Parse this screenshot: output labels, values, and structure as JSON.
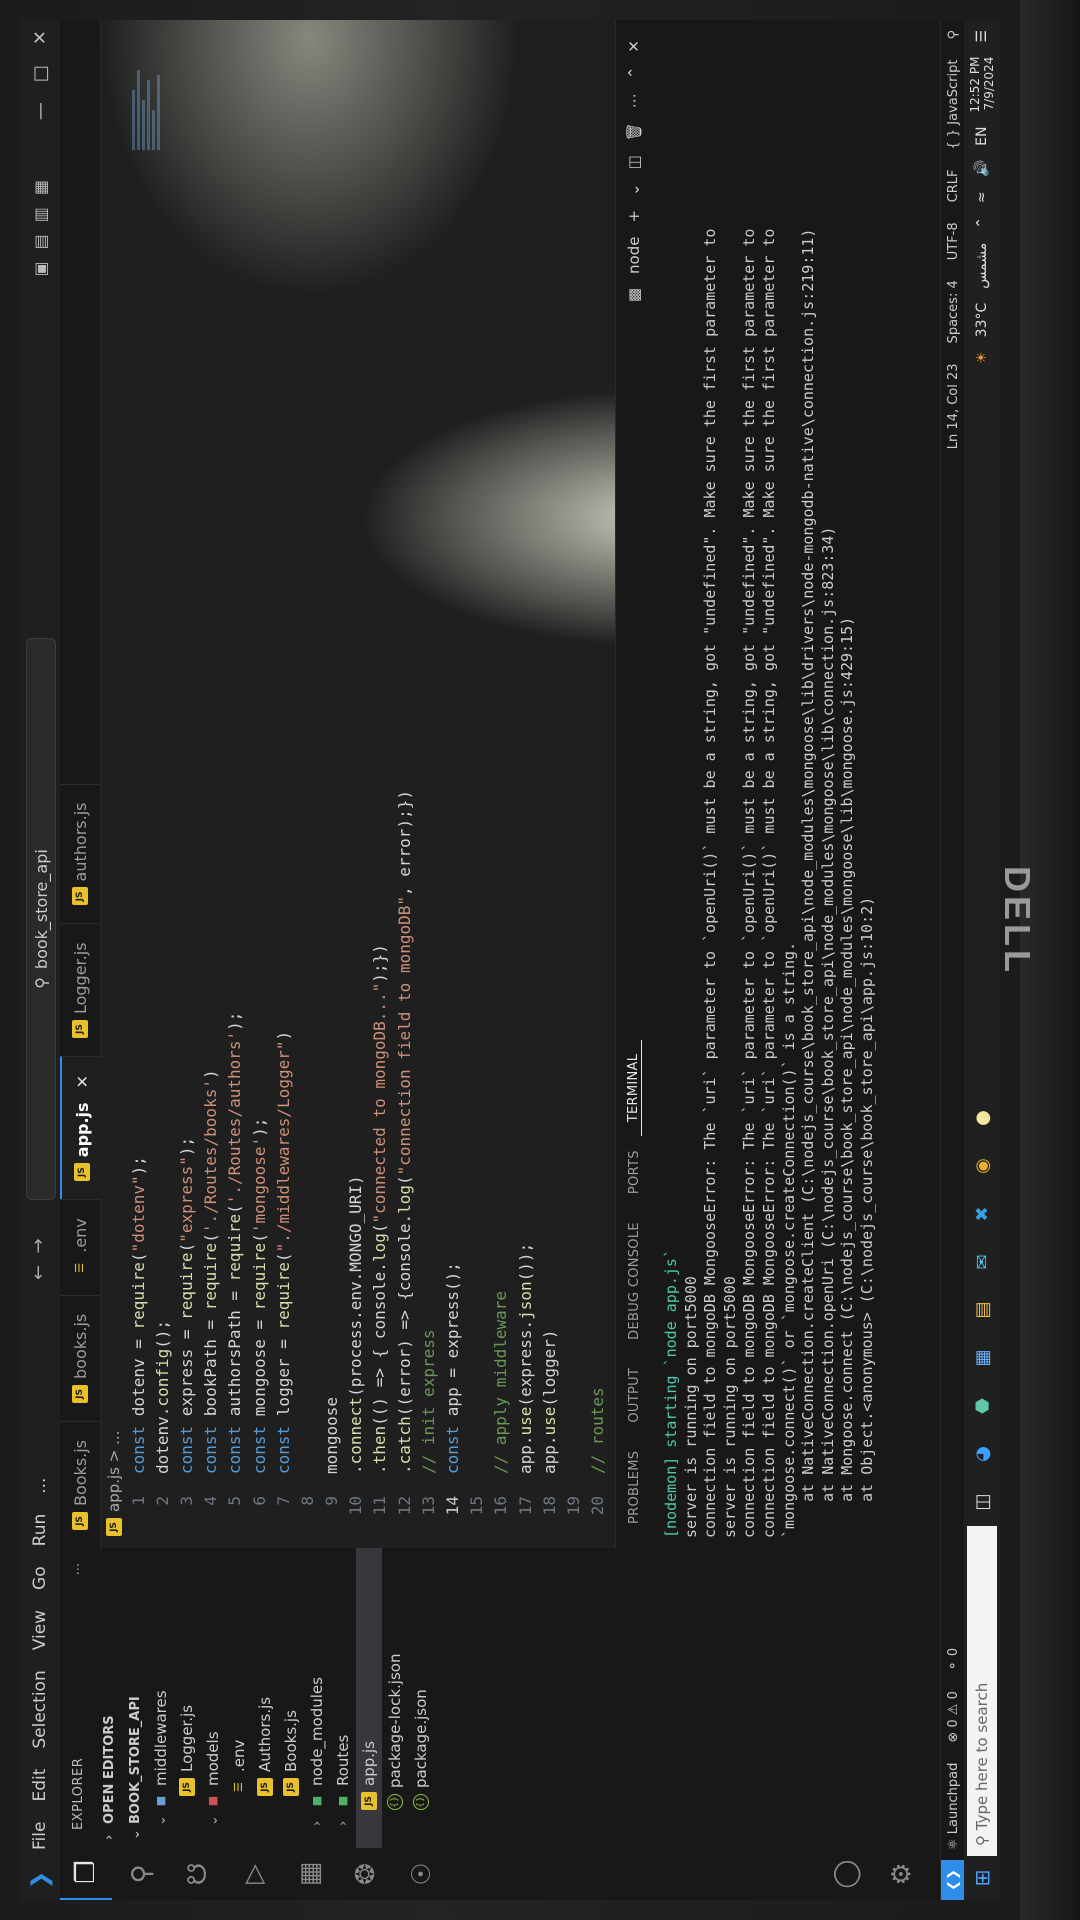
{
  "menu": [
    "File",
    "Edit",
    "Selection",
    "View",
    "Go",
    "Run",
    "..."
  ],
  "search": {
    "label": "book_store_api"
  },
  "explorer": {
    "title": "EXPLORER",
    "open_editors": "OPEN EDITORS",
    "project": "BOOK_STORE_API",
    "tree": [
      {
        "label": "middlewares",
        "indent": 1,
        "kind": "folder-blue",
        "chev": "v"
      },
      {
        "label": "Logger.js",
        "indent": 2,
        "kind": "js"
      },
      {
        "label": "models",
        "indent": 1,
        "kind": "folder-red",
        "chev": "v"
      },
      {
        "label": ".env",
        "indent": 2,
        "kind": "env"
      },
      {
        "label": "Authors.js",
        "indent": 2,
        "kind": "js"
      },
      {
        "label": "Books.js",
        "indent": 2,
        "kind": "js"
      },
      {
        "label": "node_modules",
        "indent": 1,
        "kind": "folder-green",
        "chev": ">"
      },
      {
        "label": "Routes",
        "indent": 1,
        "kind": "folder-green",
        "chev": ">"
      },
      {
        "label": "app.js",
        "indent": 1,
        "kind": "js",
        "selected": true
      },
      {
        "label": "package-lock.json",
        "indent": 1,
        "kind": "json"
      },
      {
        "label": "package.json",
        "indent": 1,
        "kind": "json"
      }
    ]
  },
  "tabs": [
    {
      "label": "Books.js"
    },
    {
      "label": "books.js"
    },
    {
      "label": ".env"
    },
    {
      "label": "app.js",
      "active": true
    },
    {
      "label": "Logger.js"
    },
    {
      "label": "authors.js"
    }
  ],
  "breadcrumb": "app.js > ...",
  "code": [
    {
      "n": "1",
      "t": "const dotenv = require(\"dotenv\");"
    },
    {
      "n": "2",
      "t": "dotenv.config();"
    },
    {
      "n": "3",
      "t": "const express = require(\"express\");"
    },
    {
      "n": "4",
      "t": "const bookPath = require('./Routes/books')"
    },
    {
      "n": "5",
      "t": "const authorsPath = require('./Routes/authors');"
    },
    {
      "n": "6",
      "t": "const mongoose = require('mongoose');"
    },
    {
      "n": "7",
      "t": "const logger = require(\"./middlewares/Logger\")"
    },
    {
      "n": "8",
      "t": ""
    },
    {
      "n": "9",
      "t": "mongoose"
    },
    {
      "n": "10",
      "t": ".connect(process.env.MONGO_URI)"
    },
    {
      "n": "11",
      "t": ".then(() => { console.log(\"connected to mongoDB...\");})"
    },
    {
      "n": "12",
      "t": ".catch((error) => {console.log(\"connection field to mongoDB\", error);})"
    },
    {
      "n": "13",
      "t": "// init express"
    },
    {
      "n": "14",
      "t": "const app = express();"
    },
    {
      "n": "15",
      "t": ""
    },
    {
      "n": "16",
      "t": "// apply middleware"
    },
    {
      "n": "17",
      "t": "app.use(express.json());"
    },
    {
      "n": "18",
      "t": "app.use(logger)"
    },
    {
      "n": "19",
      "t": ""
    },
    {
      "n": "20",
      "t": "// routes"
    }
  ],
  "panel": {
    "tabs": [
      "PROBLEMS",
      "OUTPUT",
      "DEBUG CONSOLE",
      "PORTS",
      "TERMINAL"
    ],
    "shell": "node",
    "terminal": [
      "[nodemon] starting `node app.js`",
      "server is running on port5000",
      "connection field to mongoDB MongooseError: The `uri` parameter to `openUri()` must be a string, got \"undefined\". Make sure the first parameter to",
      "server is running on port5000",
      "connection field to mongoDB MongooseError: The `uri` parameter to `openUri()` must be a string, got \"undefined\". Make sure the first parameter to",
      "connection field to mongoDB MongooseError: The `uri` parameter to `openUri()` must be a string, got \"undefined\". Make sure the first parameter to",
      "`mongoose.connect()` or `mongoose.createConnection()` is a string.",
      "    at NativeConnection.createClient (C:\\nodejs_course\\book_store_api\\node_modules\\mongoose\\lib\\drivers\\node-mongodb-native\\connection.js:219:11)",
      "    at NativeConnection.openUri (C:\\nodejs_course\\book_store_api\\node_modules\\mongoose\\lib\\connection.js:823:34)",
      "    at Mongoose.connect (C:\\nodejs_course\\book_store_api\\node_modules\\mongoose\\lib\\mongoose.js:429:15)",
      "    at Object.<anonymous> (C:\\nodejs_course\\book_store_api\\app.js:10:2)"
    ]
  },
  "status": {
    "launchpad": "Launchpad",
    "errors": "0",
    "warnings": "0",
    "ports": "0",
    "position": "Ln 14, Col 23",
    "spaces": "Spaces: 4",
    "encoding": "UTF-8",
    "eol": "CRLF",
    "language": "{ } JavaScript"
  },
  "taskbar": {
    "search_placeholder": "Type here to search",
    "lang": "EN",
    "weather": "33°C",
    "weather_desc": "مشمس",
    "time": "12:52 PM",
    "date": "7/9/2024"
  },
  "brand": "DELL"
}
